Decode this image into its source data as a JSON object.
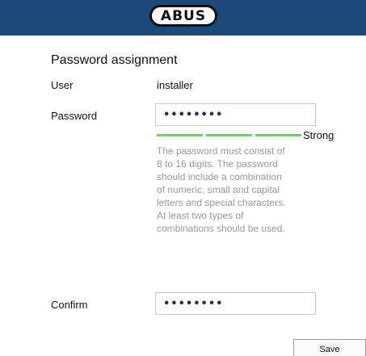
{
  "header": {
    "logo_text": "ABUS",
    "accent_color": "#1c4a78"
  },
  "form": {
    "title": "Password assignment",
    "user_label": "User",
    "user_value": "installer",
    "password_label": "Password",
    "password_value": "••••••••",
    "strength": {
      "label": "Strong",
      "filled_segments": 3,
      "total_segments": 3,
      "color": "#6cd06c"
    },
    "hint_lines": [
      "The password must consist of",
      "8 to 16 digits. The password",
      "should include a combination",
      "of numeric, small and capital",
      "letters and special characters.",
      "At least two types of",
      "combinations should be used."
    ],
    "confirm_label": "Confirm",
    "confirm_value": "••••••••"
  },
  "actions": {
    "save_label": "Save"
  }
}
